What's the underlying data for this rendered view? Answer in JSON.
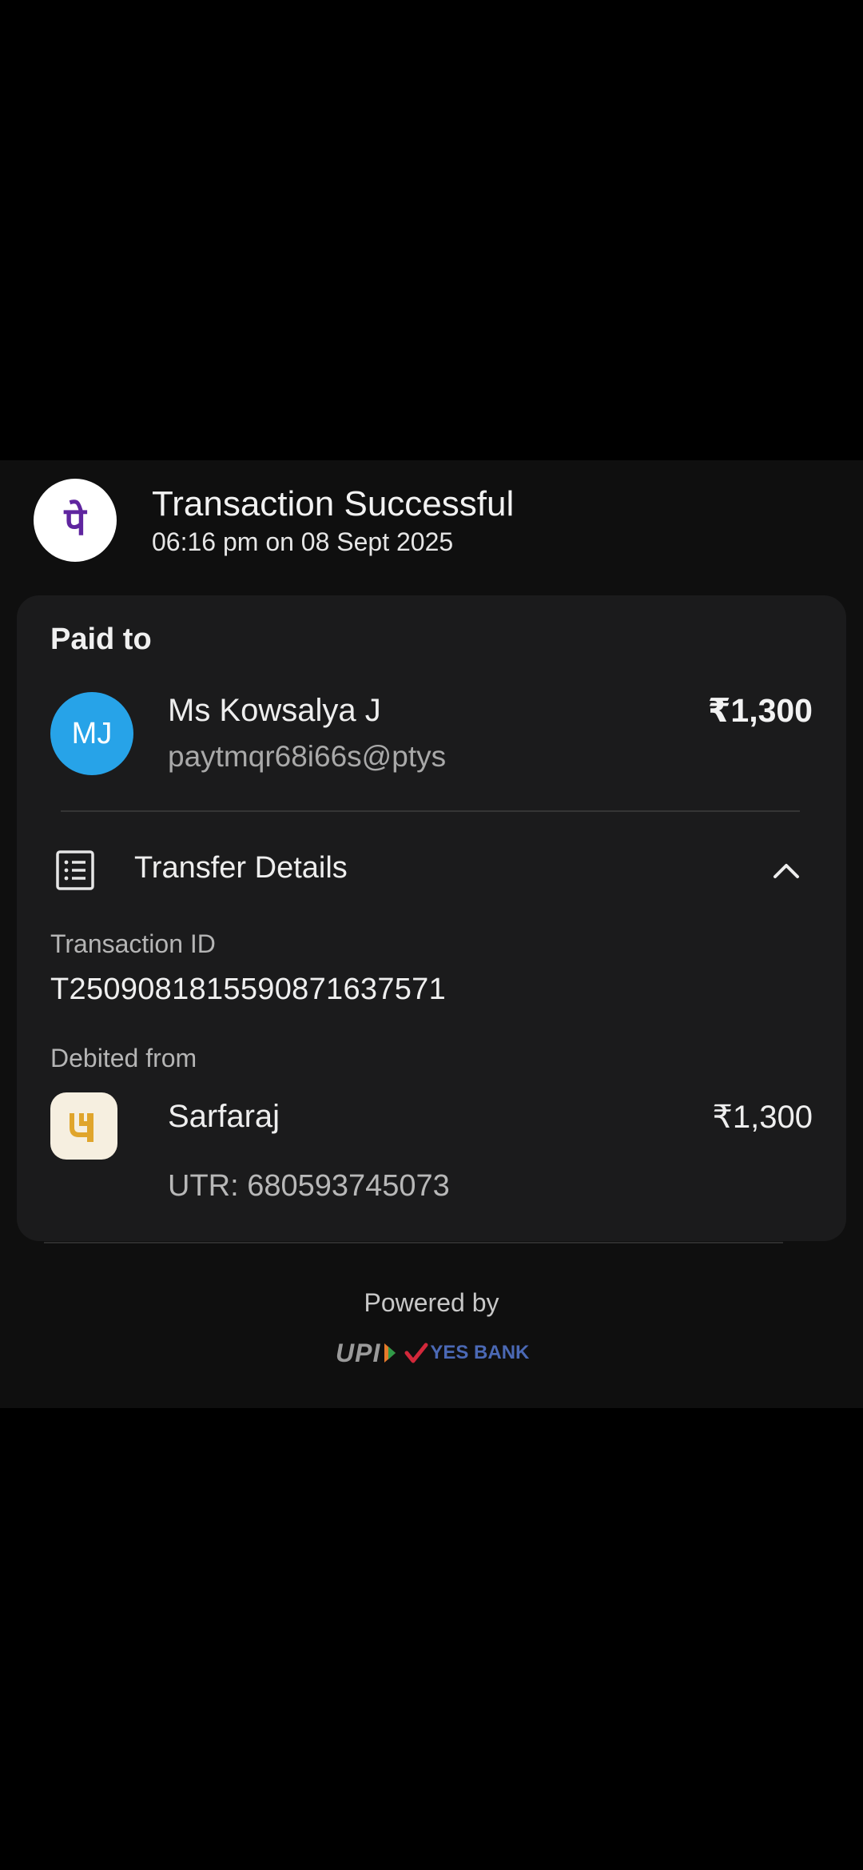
{
  "header": {
    "app_logo_icon": "phonepe-logo-icon",
    "app_logo_glyph": "पे",
    "status_title": "Transaction Successful",
    "status_time": "06:16 pm on 08 Sept 2025"
  },
  "paid_to": {
    "section_label": "Paid to",
    "avatar_initials": "MJ",
    "avatar_color": "#27a3e8",
    "name": "Ms Kowsalya J",
    "upi_id": "paytmqr68i66s@ptys",
    "amount": "₹1,300"
  },
  "transfer_details": {
    "icon": "receipt-list-icon",
    "label": "Transfer Details",
    "toggle_icon": "chevron-up-icon",
    "transaction_id_label": "Transaction ID",
    "transaction_id": "T2509081815590871637571",
    "debited_from_label": "Debited from",
    "bank_icon": "pnb-bank-icon",
    "account_name": "Sarfaraj",
    "debited_amount": "₹1,300",
    "utr": "UTR: 680593745073"
  },
  "footer": {
    "powered_by": "Powered by",
    "upi_logo": "UPI",
    "bank_logo": "YES BANK"
  }
}
